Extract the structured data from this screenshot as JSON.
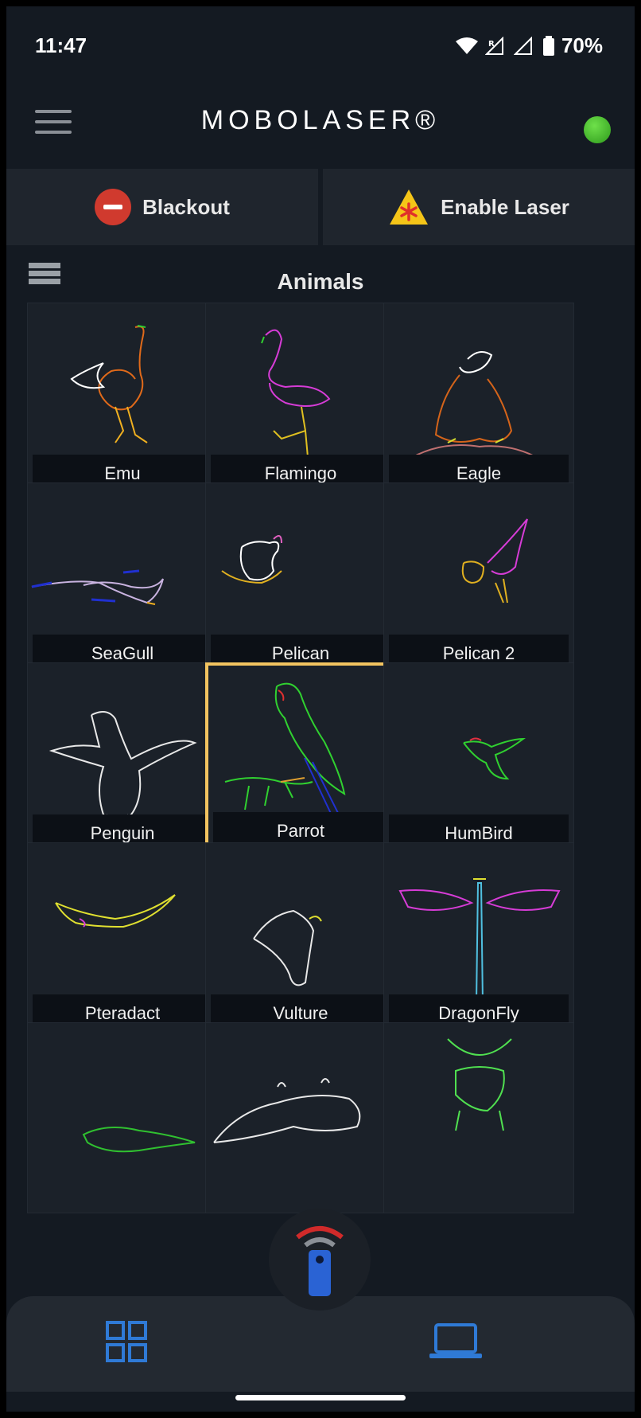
{
  "status_bar": {
    "time": "11:47",
    "battery": "70%"
  },
  "app_bar": {
    "title": "MOBOLASER®"
  },
  "actions": {
    "blackout_label": "Blackout",
    "enable_label": "Enable Laser"
  },
  "section": {
    "title": "Animals"
  },
  "tiles": [
    {
      "label": "Emu"
    },
    {
      "label": "Flamingo"
    },
    {
      "label": "Eagle"
    },
    {
      "label": "SeaGull"
    },
    {
      "label": "Pelican"
    },
    {
      "label": "Pelican 2"
    },
    {
      "label": "Penguin"
    },
    {
      "label": "Parrot",
      "selected": true
    },
    {
      "label": "HumBird"
    },
    {
      "label": "Pteradact"
    },
    {
      "label": "Vulture"
    },
    {
      "label": "DragonFly"
    }
  ],
  "colors": {
    "accent_selected": "#f3c460",
    "nav_icon": "#2f7ad6",
    "status_online": "#3fbf2a",
    "blackout": "#d03a2e",
    "warning": "#f5c518"
  },
  "icons": [
    "hamburger-icon",
    "wifi-icon",
    "signal-icon",
    "battery-icon",
    "list-view-icon",
    "grid-view-icon",
    "remote-icon",
    "laptop-icon"
  ]
}
